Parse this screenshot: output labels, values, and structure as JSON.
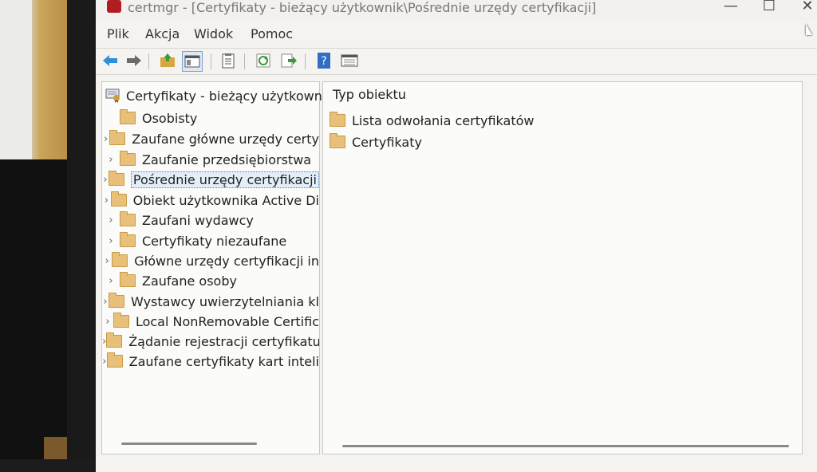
{
  "window": {
    "title": "certmgr - [Certyfikaty - bieżący użytkownik\\Pośrednie urzędy certyfikacji]",
    "minimize_glyph": "—",
    "maximize_glyph": "☐",
    "close_glyph": "✕"
  },
  "menu": [
    "Plik",
    "Akcja",
    "Widok",
    "Pomoc"
  ],
  "toolbar": {
    "icons": [
      "back-arrow-icon",
      "forward-arrow-icon",
      "up-folder-icon",
      "show-hide-tree-icon",
      "properties-icon",
      "refresh-icon",
      "export-list-icon",
      "help-icon",
      "console-view-icon"
    ],
    "help_glyph": "?"
  },
  "tree": {
    "root_label": "Certyfikaty - bieżący użytkownik",
    "items": [
      {
        "label": "Osobisty",
        "expandable": false,
        "selected": false
      },
      {
        "label": "Zaufane główne urzędy certy",
        "expandable": true,
        "selected": false
      },
      {
        "label": "Zaufanie przedsiębiorstwa",
        "expandable": true,
        "selected": false
      },
      {
        "label": "Pośrednie urzędy certyfikacji",
        "expandable": true,
        "selected": true
      },
      {
        "label": "Obiekt użytkownika Active Di",
        "expandable": true,
        "selected": false
      },
      {
        "label": "Zaufani wydawcy",
        "expandable": true,
        "selected": false
      },
      {
        "label": "Certyfikaty niezaufane",
        "expandable": true,
        "selected": false
      },
      {
        "label": "Główne urzędy certyfikacji in",
        "expandable": true,
        "selected": false
      },
      {
        "label": "Zaufane osoby",
        "expandable": true,
        "selected": false
      },
      {
        "label": "Wystawcy uwierzytelniania kl",
        "expandable": true,
        "selected": false
      },
      {
        "label": "Local NonRemovable Certific",
        "expandable": true,
        "selected": false
      },
      {
        "label": "Żądanie rejestracji certyfikatu",
        "expandable": true,
        "selected": false
      },
      {
        "label": "Zaufane certyfikaty kart inteli",
        "expandable": true,
        "selected": false
      }
    ]
  },
  "detail": {
    "column_header": "Typ obiektu",
    "items": [
      "Lista odwołania certyfikatów",
      "Certyfikaty"
    ]
  },
  "colors": {
    "folder": "#e8c07a",
    "selection": "#e4eef9",
    "arrow_blue": "#2f8fd8",
    "help_blue": "#2f6ec0"
  }
}
